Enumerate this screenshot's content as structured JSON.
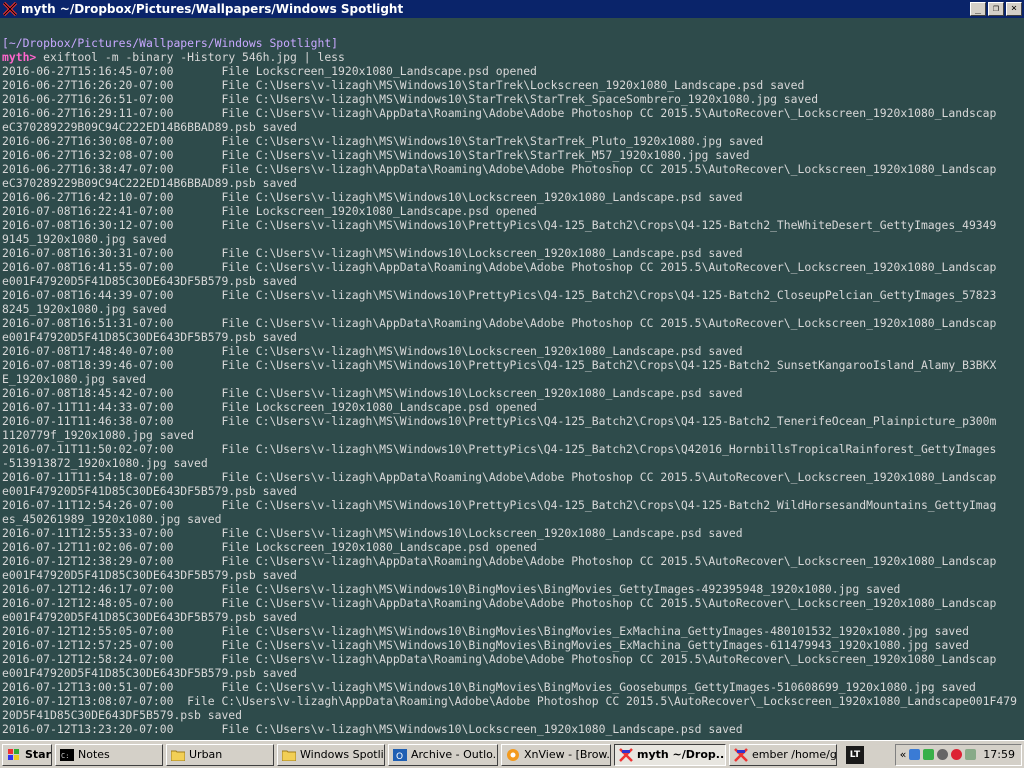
{
  "window": {
    "title": "myth ~/Dropbox/Pictures/Wallpapers/Windows Spotlight"
  },
  "terminal": {
    "prompt_path": "[~/Dropbox/Pictures/Wallpapers/Windows Spotlight]",
    "prompt_user": "myth>",
    "command": " exiftool -m -binary -History 546h.jpg | less",
    "output_lines": [
      "2016-06-27T15:16:45-07:00       File Lockscreen_1920x1080_Landscape.psd opened",
      "2016-06-27T16:26:20-07:00       File C:\\Users\\v-lizagh\\MS\\Windows10\\StarTrek\\Lockscreen_1920x1080_Landscape.psd saved",
      "2016-06-27T16:26:51-07:00       File C:\\Users\\v-lizagh\\MS\\Windows10\\StarTrek\\StarTrek_SpaceSombrero_1920x1080.jpg saved",
      "2016-06-27T16:29:11-07:00       File C:\\Users\\v-lizagh\\AppData\\Roaming\\Adobe\\Adobe Photoshop CC 2015.5\\AutoRecover\\_Lockscreen_1920x1080_Landscap",
      "eC370289229B09C94C222ED14B6BBAD89.psb saved",
      "2016-06-27T16:30:08-07:00       File C:\\Users\\v-lizagh\\MS\\Windows10\\StarTrek\\StarTrek_Pluto_1920x1080.jpg saved",
      "2016-06-27T16:32:08-07:00       File C:\\Users\\v-lizagh\\MS\\Windows10\\StarTrek\\StarTrek_M57_1920x1080.jpg saved",
      "2016-06-27T16:38:47-07:00       File C:\\Users\\v-lizagh\\AppData\\Roaming\\Adobe\\Adobe Photoshop CC 2015.5\\AutoRecover\\_Lockscreen_1920x1080_Landscap",
      "eC370289229B09C94C222ED14B6BBAD89.psb saved",
      "2016-06-27T16:42:10-07:00       File C:\\Users\\v-lizagh\\MS\\Windows10\\Lockscreen_1920x1080_Landscape.psd saved",
      "2016-07-08T16:22:41-07:00       File Lockscreen_1920x1080_Landscape.psd opened",
      "2016-07-08T16:30:12-07:00       File C:\\Users\\v-lizagh\\MS\\Windows10\\PrettyPics\\Q4-125_Batch2\\Crops\\Q4-125-Batch2_TheWhiteDesert_GettyImages_49349",
      "9145_1920x1080.jpg saved",
      "2016-07-08T16:30:31-07:00       File C:\\Users\\v-lizagh\\MS\\Windows10\\Lockscreen_1920x1080_Landscape.psd saved",
      "2016-07-08T16:41:55-07:00       File C:\\Users\\v-lizagh\\AppData\\Roaming\\Adobe\\Adobe Photoshop CC 2015.5\\AutoRecover\\_Lockscreen_1920x1080_Landscap",
      "e001F47920D5F41D85C30DE643DF5B579.psb saved",
      "2016-07-08T16:44:39-07:00       File C:\\Users\\v-lizagh\\MS\\Windows10\\PrettyPics\\Q4-125_Batch2\\Crops\\Q4-125-Batch2_CloseupPelcian_GettyImages_57823",
      "8245_1920x1080.jpg saved",
      "2016-07-08T16:51:31-07:00       File C:\\Users\\v-lizagh\\AppData\\Roaming\\Adobe\\Adobe Photoshop CC 2015.5\\AutoRecover\\_Lockscreen_1920x1080_Landscap",
      "e001F47920D5F41D85C30DE643DF5B579.psb saved",
      "2016-07-08T17:48:40-07:00       File C:\\Users\\v-lizagh\\MS\\Windows10\\Lockscreen_1920x1080_Landscape.psd saved",
      "2016-07-08T18:39:46-07:00       File C:\\Users\\v-lizagh\\MS\\Windows10\\PrettyPics\\Q4-125_Batch2\\Crops\\Q4-125-Batch2_SunsetKangarooIsland_Alamy_B3BKX",
      "E_1920x1080.jpg saved",
      "2016-07-08T18:45:42-07:00       File C:\\Users\\v-lizagh\\MS\\Windows10\\Lockscreen_1920x1080_Landscape.psd saved",
      "2016-07-11T11:44:33-07:00       File Lockscreen_1920x1080_Landscape.psd opened",
      "2016-07-11T11:46:38-07:00       File C:\\Users\\v-lizagh\\MS\\Windows10\\PrettyPics\\Q4-125_Batch2\\Crops\\Q4-125-Batch2_TenerifeOcean_Plainpicture_p300m",
      "1120779f_1920x1080.jpg saved",
      "2016-07-11T11:50:02-07:00       File C:\\Users\\v-lizagh\\MS\\Windows10\\PrettyPics\\Q4-125_Batch2\\Crops\\Q42016_HornbillsTropicalRainforest_GettyImages",
      "-513913872_1920x1080.jpg saved",
      "2016-07-11T11:54:18-07:00       File C:\\Users\\v-lizagh\\AppData\\Roaming\\Adobe\\Adobe Photoshop CC 2015.5\\AutoRecover\\_Lockscreen_1920x1080_Landscap",
      "e001F47920D5F41D85C30DE643DF5B579.psb saved",
      "2016-07-11T12:54:26-07:00       File C:\\Users\\v-lizagh\\MS\\Windows10\\PrettyPics\\Q4-125_Batch2\\Crops\\Q4-125-Batch2_WildHorsesandMountains_GettyImag",
      "es_450261989_1920x1080.jpg saved",
      "2016-07-11T12:55:33-07:00       File C:\\Users\\v-lizagh\\MS\\Windows10\\Lockscreen_1920x1080_Landscape.psd saved",
      "2016-07-12T11:02:06-07:00       File Lockscreen_1920x1080_Landscape.psd opened",
      "2016-07-12T12:38:29-07:00       File C:\\Users\\v-lizagh\\AppData\\Roaming\\Adobe\\Adobe Photoshop CC 2015.5\\AutoRecover\\_Lockscreen_1920x1080_Landscap",
      "e001F47920D5F41D85C30DE643DF5B579.psb saved",
      "2016-07-12T12:46:17-07:00       File C:\\Users\\v-lizagh\\MS\\Windows10\\BingMovies\\BingMovies_GettyImages-492395948_1920x1080.jpg saved",
      "2016-07-12T12:48:05-07:00       File C:\\Users\\v-lizagh\\AppData\\Roaming\\Adobe\\Adobe Photoshop CC 2015.5\\AutoRecover\\_Lockscreen_1920x1080_Landscap",
      "e001F47920D5F41D85C30DE643DF5B579.psb saved",
      "2016-07-12T12:55:05-07:00       File C:\\Users\\v-lizagh\\MS\\Windows10\\BingMovies\\BingMovies_ExMachina_GettyImages-480101532_1920x1080.jpg saved",
      "2016-07-12T12:57:25-07:00       File C:\\Users\\v-lizagh\\MS\\Windows10\\BingMovies\\BingMovies_ExMachina_GettyImages-611479943_1920x1080.jpg saved",
      "2016-07-12T12:58:24-07:00       File C:\\Users\\v-lizagh\\AppData\\Roaming\\Adobe\\Adobe Photoshop CC 2015.5\\AutoRecover\\_Lockscreen_1920x1080_Landscap",
      "e001F47920D5F41D85C30DE643DF5B579.psb saved",
      "2016-07-12T13:00:51-07:00       File C:\\Users\\v-lizagh\\MS\\Windows10\\BingMovies\\BingMovies_Goosebumps_GettyImages-510608699_1920x1080.jpg saved",
      "2016-07-12T13:08:07-07:00  File C:\\Users\\v-lizagh\\AppData\\Roaming\\Adobe\\Adobe Photoshop CC 2015.5\\AutoRecover\\_Lockscreen_1920x1080_Landscape001F479",
      "20D5F41D85C30DE643DF5B579.psb saved",
      "2016-07-12T13:23:20-07:00       File C:\\Users\\v-lizagh\\MS\\Windows10\\Lockscreen_1920x1080_Landscape.psd saved"
    ]
  },
  "taskbar": {
    "start_label": "Start",
    "buttons": [
      {
        "label": "Notes",
        "icon": "cmd-icon"
      },
      {
        "label": "Urban",
        "icon": "folder-icon"
      },
      {
        "label": "Windows Spotli...",
        "icon": "folder-icon"
      },
      {
        "label": "Archive - Outlo...",
        "icon": "outlook-icon"
      },
      {
        "label": "XnView - [Brow...",
        "icon": "xnview-icon"
      },
      {
        "label": "myth ~/Drop...",
        "icon": "terminal-icon",
        "active": true
      },
      {
        "label": "ember /home/g...",
        "icon": "terminal-icon"
      }
    ],
    "lt_label": "LT",
    "tray_chevron": "«",
    "clock": "17:59"
  },
  "colors": {
    "titlebar": "#0a246a",
    "terminal_bg": "#2e4b4b",
    "terminal_fg": "#d8d8d8",
    "prompt_path": "#c8a8ff",
    "prompt_user": "#ff66cc",
    "taskbar": "#d4d0c8"
  }
}
